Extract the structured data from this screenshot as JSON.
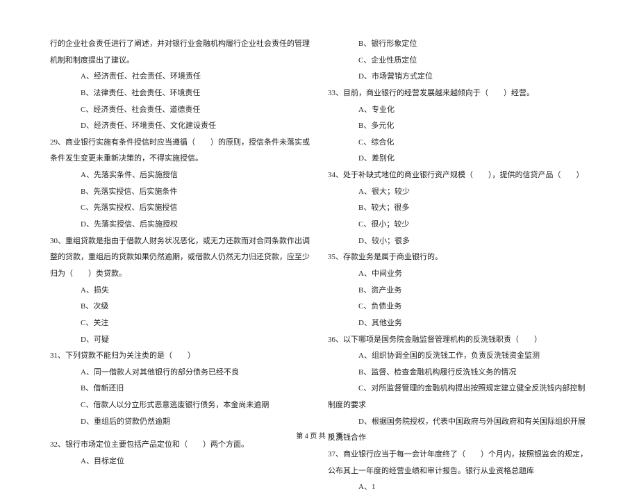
{
  "left": {
    "intro_cont": "行的企业社会责任进行了阐述，并对银行业金融机构履行企业社会责任的管理机制和制度提出了建议。",
    "q28_opts": [
      "A、经济责任、社会责任、环境责任",
      "B、法律责任、社会责任、环境责任",
      "C、经济责任、社会责任、道德责任",
      "D、经济责任、环境责任、文化建设责任"
    ],
    "q29": "29、商业银行实施有条件授信时应当遵循（　　）的原则，授信条件未落实或条件发生变更未重新决策的，不得实施授信。",
    "q29_opts": [
      "A、先落实条件、后实施授信",
      "B、先落实授信、后实施条件",
      "C、先落实授权、后实施授信",
      "D、先落实授信、后实施授权"
    ],
    "q30": "30、重组贷款是指由于借款人财务状况恶化，或无力还款而对合同条款作出调整的贷款，重组后的贷款如果仍然逾期，或借款人仍然无力归还贷款，应至少归为（　　）类贷款。",
    "q30_opts": [
      "A、损失",
      "B、次级",
      "C、关注",
      "D、可疑"
    ],
    "q31": "31、下列贷款不能归为关注类的是（　　）",
    "q31_opts": [
      "A、同一借款人对其他银行的部分债务已经不良",
      "B、借新还旧",
      "C、借款人以分立形式恶意逃废银行债务，本金尚未逾期",
      "D、重组后的贷款仍然逾期"
    ],
    "q32": "32、银行市场定位主要包括产品定位和（　　）两个方面。",
    "q32_opts": [
      "A、目标定位"
    ]
  },
  "right": {
    "q32_opts_cont": [
      "B、银行形象定位",
      "C、企业性质定位",
      "D、市场营销方式定位"
    ],
    "q33": "33、目前，商业银行的经营发展越来越倾向于（　　）经营。",
    "q33_opts": [
      "A、专业化",
      "B、多元化",
      "C、综合化",
      "D、差别化"
    ],
    "q34": "34、处于补缺式地位的商业银行资产规模（　　），提供的信贷产品（　　）",
    "q34_opts": [
      "A、很大；较少",
      "B、较大；很多",
      "C、很小；较少",
      "D、较小；很多"
    ],
    "q35": "35、存款业务是属于商业银行的。",
    "q35_opts": [
      "A、中间业务",
      "B、资产业务",
      "C、负债业务",
      "D、其他业务"
    ],
    "q36": "36、以下哪项是国务院金融监督管理机构的反洗钱职责（　　）",
    "q36_opts": [
      "A、组织协调全国的反洗钱工作，负责反洗钱资金监测",
      "B、监督、检查金融机构履行反洗钱义务的情况",
      "C、对所监督管理的金融机构提出按照规定建立健全反洗钱内部控制制度的要求",
      "D、根据国务院授权，代表中国政府与外国政府和有关国际组织开展反洗钱合作"
    ],
    "q37": "37、商业银行应当于每一会计年度终了（　　）个月内，按照银监会的规定，公布其上一年度的经营业绩和审计报告。银行从业资格总题库",
    "q37_opts": [
      "A、1"
    ]
  },
  "footer": "第 4 页 共 18 页"
}
